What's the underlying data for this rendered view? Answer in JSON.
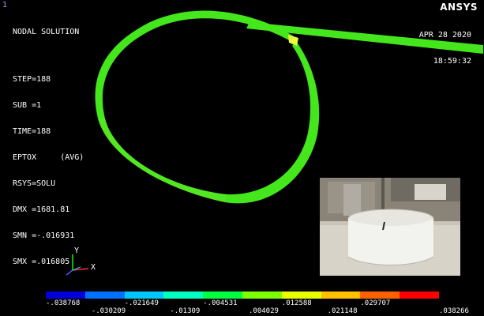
{
  "window": {
    "number": "1",
    "logo": "ANSYS"
  },
  "info": {
    "title": "NODAL SOLUTION",
    "step": "STEP=188",
    "sub": "SUB =1",
    "time": "TIME=188",
    "result": "EPTOX     (AVG)",
    "rsys": "RSYS=SOLU",
    "dmx": "DMX =1681.81",
    "smn": "SMN =-.016931",
    "smx": "SMX =.016805"
  },
  "timestamp": {
    "date": "APR 28 2020",
    "time": "18:59:32"
  },
  "triad": {
    "y_label": "Y",
    "x_label": "X"
  },
  "legend": {
    "colors": [
      "#0000d8",
      "#0070ff",
      "#00c8ff",
      "#00ffc0",
      "#00ff40",
      "#7cff00",
      "#e8ff00",
      "#ffc000",
      "#ff6000",
      "#ff0000"
    ],
    "labels_top": [
      "-.038768",
      "-.021649",
      "-.004531",
      ".012588",
      ".029707"
    ],
    "labels_bottom": [
      "-.030209",
      "-.01309",
      ".004029",
      ".021148",
      ".038266"
    ]
  },
  "colors": {
    "strip": "#44e61c",
    "strip_alt": "#7cd82a",
    "strip_hot": "#e8ff40"
  }
}
